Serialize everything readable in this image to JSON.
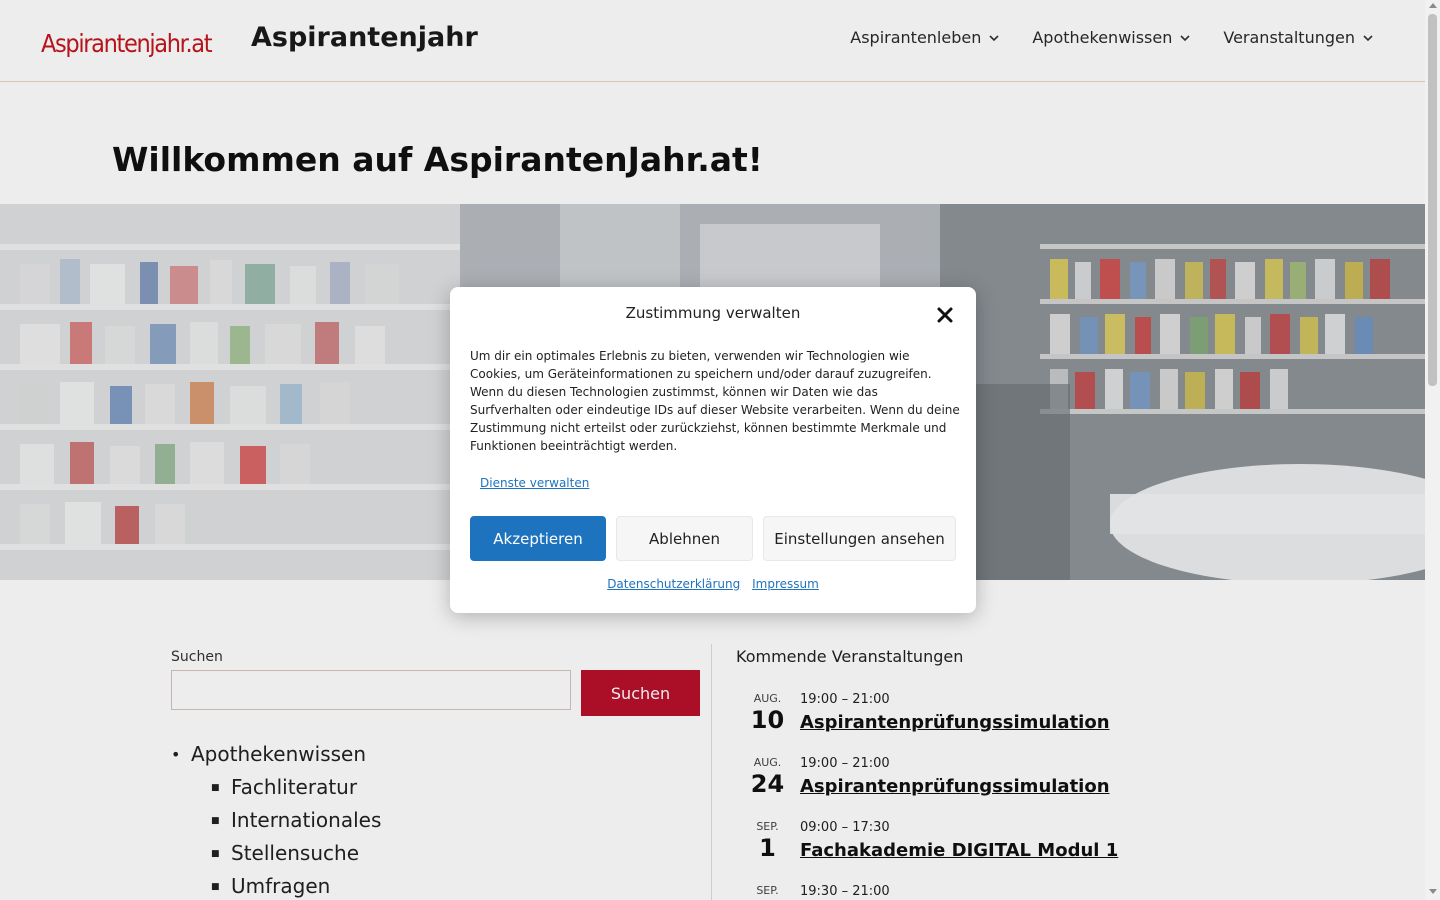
{
  "header": {
    "logo_text": "Aspirantenjahr.at",
    "site_title": "Aspirantenjahr",
    "nav": [
      {
        "label": "Aspirantenleben"
      },
      {
        "label": "Apothekenwissen"
      },
      {
        "label": "Veranstaltungen"
      }
    ]
  },
  "page_title": "Willkommen auf AspirantenJahr.at!",
  "search": {
    "label": "Suchen",
    "value": "",
    "placeholder": "",
    "button_label": "Suchen"
  },
  "categories": {
    "top": "Apothekenwissen",
    "children": [
      "Fachliteratur",
      "Internationales",
      "Stellensuche",
      "Umfragen"
    ]
  },
  "events": {
    "title": "Kommende Veranstaltungen",
    "items": [
      {
        "month": "AUG.",
        "day": "10",
        "time": "19:00 – 21:00",
        "title": "Aspirantenprüfungssimulation"
      },
      {
        "month": "AUG.",
        "day": "24",
        "time": "19:00 – 21:00",
        "title": "Aspirantenprüfungssimulation"
      },
      {
        "month": "SEP.",
        "day": "1",
        "time": "09:00 – 17:30",
        "title": "Fachakademie DIGITAL Modul 1"
      },
      {
        "month": "SEP.",
        "day": "",
        "time": "19:30 – 21:00",
        "title": ""
      }
    ]
  },
  "consent": {
    "title": "Zustimmung verwalten",
    "body": "Um dir ein optimales Erlebnis zu bieten, verwenden wir Technologien wie Cookies, um Geräteinformationen zu speichern und/oder darauf zuzugreifen. Wenn du diesen Technologien zustimmst, können wir Daten wie das Surfverhalten oder eindeutige IDs auf dieser Website verarbeiten. Wenn du deine Zustimmung nicht erteilst oder zurückziehst, können bestimmte Merkmale und Funktionen beeinträchtigt werden.",
    "manage_link": "Dienste verwalten",
    "accept_label": "Akzeptieren",
    "deny_label": "Ablehnen",
    "settings_label": "Einstellungen ansehen",
    "privacy_link": "Datenschutzerklärung",
    "imprint_link": "Impressum"
  },
  "colors": {
    "brand_red": "#c4161c",
    "search_button": "#b9102b",
    "accept_button": "#1e73be"
  }
}
